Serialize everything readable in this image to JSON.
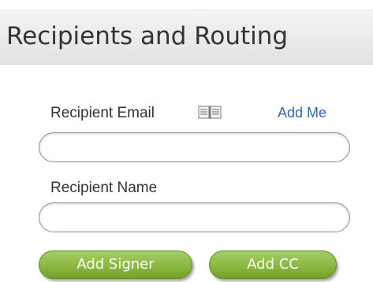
{
  "header": {
    "title": "Recipients and Routing"
  },
  "form": {
    "email_label": "Recipient Email",
    "address_book_icon": "address-book-icon",
    "add_me_label": "Add Me",
    "email_value": "",
    "name_label": "Recipient Name",
    "name_value": ""
  },
  "actions": {
    "add_signer_label": "Add Signer",
    "add_cc_label": "Add CC"
  },
  "colors": {
    "header_bg": "#ececec",
    "link": "#2e6ab1",
    "button_green": "#8cba44",
    "text": "#333333"
  }
}
